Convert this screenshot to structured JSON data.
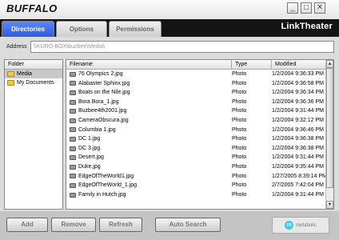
{
  "window": {
    "logo": "BUFFALO",
    "minimize_glyph": "_",
    "maximize_glyph": "□",
    "close_glyph": "✕"
  },
  "tabs": [
    {
      "label": "Directories",
      "active": true
    },
    {
      "label": "Options",
      "active": false
    },
    {
      "label": "Permissions",
      "active": false
    }
  ],
  "brand": "LinkTheater",
  "address": {
    "label": "Address",
    "value": "\\\\KURO-BOX\\buzbee\\Media\\"
  },
  "folders": {
    "header": "Folder",
    "items": [
      {
        "label": "Media",
        "selected": true
      },
      {
        "label": "My Documents",
        "selected": false
      }
    ]
  },
  "files": {
    "columns": {
      "filename": "Filename",
      "type": "Type",
      "modified": "Modified"
    },
    "rows": [
      {
        "name": "76 Olympics 2.jpg",
        "type": "Photo",
        "modified": "1/2/2004 9:36:33 PM"
      },
      {
        "name": "Alabaster Sphinx.jpg",
        "type": "Photo",
        "modified": "1/2/2004 9:36:58 PM"
      },
      {
        "name": "Boats on the Nile.jpg",
        "type": "Photo",
        "modified": "1/2/2004 9:36:34 PM"
      },
      {
        "name": "Bora Bora_1.jpg",
        "type": "Photo",
        "modified": "1/2/2004 9:36:36 PM"
      },
      {
        "name": "Buzbee4th2001.jpg",
        "type": "Photo",
        "modified": "1/2/2004 9:31:44 PM"
      },
      {
        "name": "CameraObscura.jpg",
        "type": "Photo",
        "modified": "1/2/2004 9:32:12 PM"
      },
      {
        "name": "Columbia 1.jpg",
        "type": "Photo",
        "modified": "1/2/2004 9:36:46 PM"
      },
      {
        "name": "DC 1.jpg",
        "type": "Photo",
        "modified": "1/2/2004 9:36:38 PM"
      },
      {
        "name": "DC 3.jpg",
        "type": "Photo",
        "modified": "1/2/2004 9:36:38 PM"
      },
      {
        "name": "Desert.jpg",
        "type": "Photo",
        "modified": "1/2/2004 9:31:44 PM"
      },
      {
        "name": "Duke.jpg",
        "type": "Photo",
        "modified": "1/2/2004 9:35:44 PM"
      },
      {
        "name": "EdgeOfTheWorld1.jpg",
        "type": "Photo",
        "modified": "1/27/2005 8:39:14 PM"
      },
      {
        "name": "EdgeOfTheWorld_1.jpg",
        "type": "Photo",
        "modified": "2/7/2005 7:42:04 PM"
      },
      {
        "name": "Family in Hutch.jpg",
        "type": "Photo",
        "modified": "1/2/2004 9:31:44 PM"
      }
    ]
  },
  "scrollbar": {
    "up_glyph": "▲",
    "down_glyph": "▼"
  },
  "buttons": {
    "add": "Add",
    "remove": "Remove",
    "refresh": "Refresh",
    "auto_search": "Auto Search"
  },
  "metabolic": {
    "icon_letter": "m",
    "text": "metabolic"
  },
  "colors": {
    "active_tab": "#3f6ff0",
    "folder": "#f2c93c",
    "selection": "#c8c8c8"
  }
}
